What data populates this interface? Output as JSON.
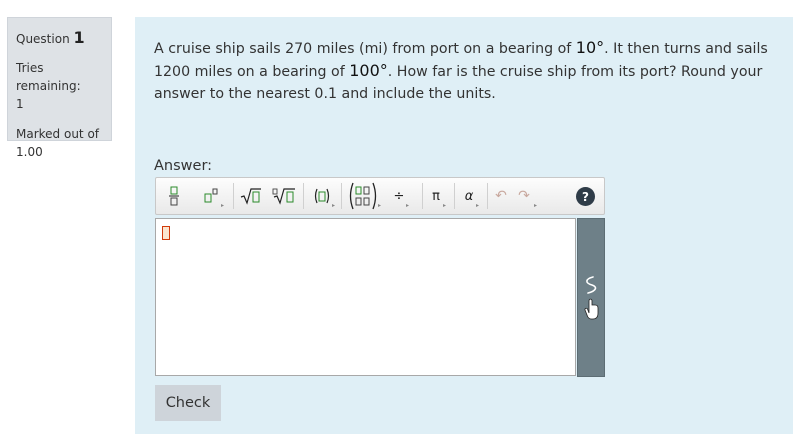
{
  "info": {
    "question_label": "Question",
    "question_number": "1",
    "tries_label": "Tries remaining:",
    "tries_value": "1",
    "marked_label": "Marked out of",
    "marked_value": "1.00"
  },
  "question": {
    "part1": "A cruise ship sails 270 miles (mi) from port on a bearing of ",
    "angle1": "10°",
    "part2": ". It then turns and sails 1200 miles on a bearing of ",
    "angle2": "100°",
    "part3": ". How far is the cruise ship from its port? Round your answer to the nearest 0.1 and include the units."
  },
  "answer_label": "Answer:",
  "toolbar": {
    "fraction": "▯/▯",
    "superscript": "▯▯",
    "sqrt": "√▯",
    "nthroot": "∜▯",
    "parens": "(▯)",
    "matrix": "▯▯",
    "divide": "÷",
    "pi": "π",
    "alpha": "α",
    "undo": "↶",
    "redo": "↷",
    "help": "?"
  },
  "check_label": "Check",
  "colors": {
    "content_bg": "#dfeff6",
    "info_bg": "#dee2e6",
    "sidebar": "#6e8088"
  }
}
